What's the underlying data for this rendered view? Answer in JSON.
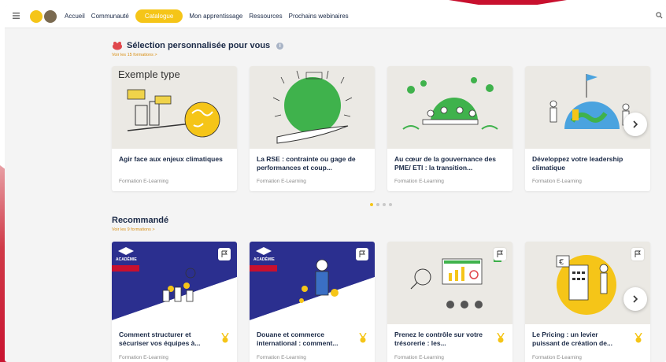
{
  "nav": {
    "items": [
      "Accueil",
      "Communauté",
      "Catalogue",
      "Mon apprentissage",
      "Ressources",
      "Prochains webinaires"
    ],
    "active_index": 2
  },
  "section1": {
    "title": "Sélection personnalisée pour vous",
    "see_all": "Voir les 15 formations  >",
    "cards": [
      {
        "title": "Agir face aux enjeux climatiques",
        "type": "Formation E-Learning",
        "overlay": "Exemple type",
        "icon": "climate-scale-illustration"
      },
      {
        "title": "La RSE : contrainte ou gage de performances et coup...",
        "type": "Formation E-Learning",
        "icon": "hand-earth-illustration"
      },
      {
        "title": "Au cœur de la gouvernance des PME/ ETI : la transition...",
        "type": "Formation E-Learning",
        "icon": "meeting-globe-illustration"
      },
      {
        "title": "Développez votre leadership climatique",
        "type": "Formation E-Learning",
        "icon": "people-globe-illustration"
      }
    ]
  },
  "section2": {
    "title": "Recommandé",
    "see_all": "Voir les 9 formations  >",
    "cards": [
      {
        "title": "Comment structurer et sécuriser vos équipes à...",
        "type": "Formation E-Learning",
        "badge": "ACADÉMIE",
        "icon": "team-illustration"
      },
      {
        "title": "Douane et commerce international : comment...",
        "type": "Formation E-Learning",
        "badge": "ACADÉMIE",
        "icon": "customs-illustration"
      },
      {
        "title": "Prenez le contrôle sur votre trésorerie : les...",
        "type": "Formation E-Learning",
        "icon": "treasury-illustration"
      },
      {
        "title": "Le Pricing : un levier puissant de création de...",
        "type": "Formation E-Learning",
        "icon": "pricing-illustration"
      }
    ]
  },
  "carousel": {
    "pages": 4,
    "current_page": 1
  },
  "colors": {
    "accent": "#f5c518",
    "navy": "#1b2a47",
    "link": "#d88e12",
    "brand_red": "#c8102e"
  }
}
